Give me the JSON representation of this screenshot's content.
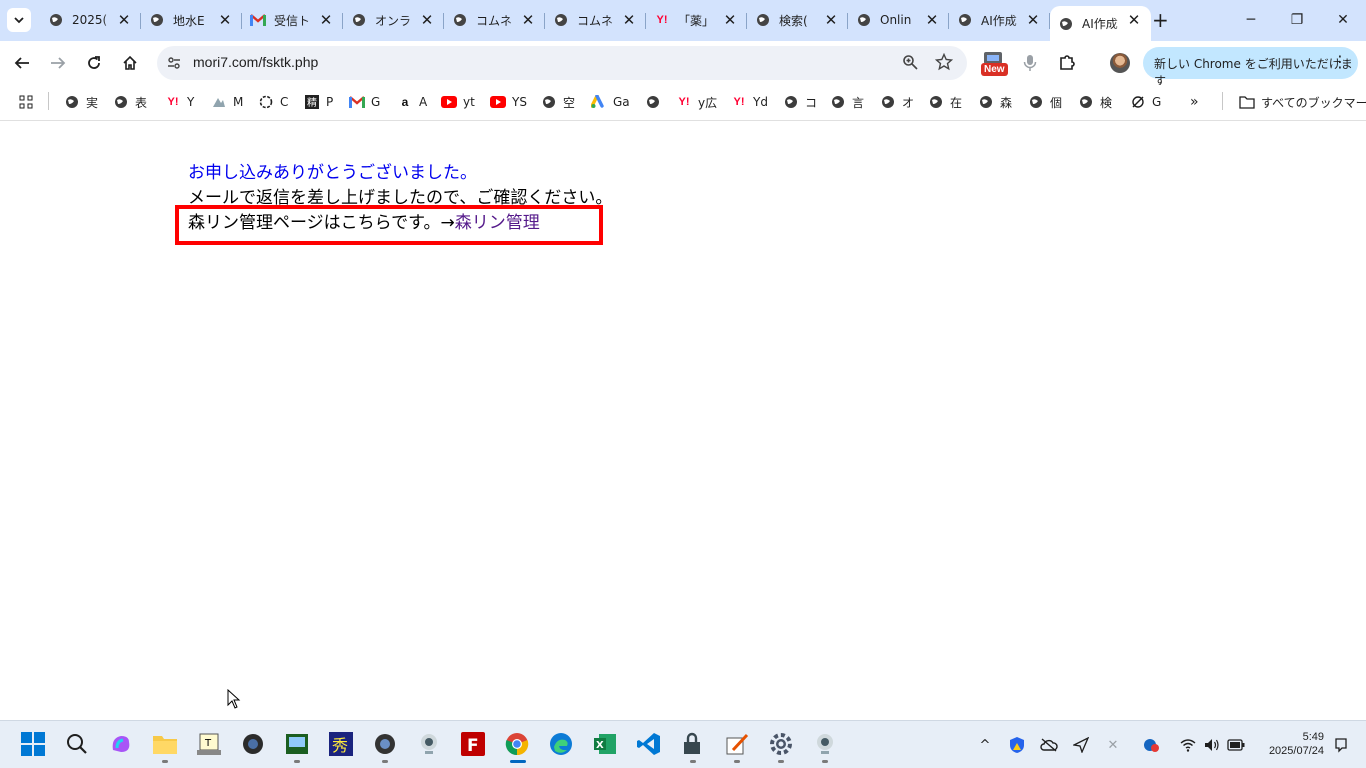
{
  "browser": {
    "tabs": [
      {
        "title": "2025(",
        "favicon": "globe-icon"
      },
      {
        "title": "地水E",
        "favicon": "globe-icon"
      },
      {
        "title": "受信ト",
        "favicon": "gmail-icon"
      },
      {
        "title": "オンラ",
        "favicon": "globe-icon"
      },
      {
        "title": "コムネ",
        "favicon": "globe-icon"
      },
      {
        "title": "コムネ",
        "favicon": "globe-icon"
      },
      {
        "title": "「薬」",
        "favicon": "yahoo-icon"
      },
      {
        "title": "検索(",
        "favicon": "globe-icon"
      },
      {
        "title": "Onlin",
        "favicon": "globe-icon"
      },
      {
        "title": "AI作成",
        "favicon": "globe-icon"
      },
      {
        "title": "AI作成",
        "favicon": "globe-icon",
        "active": true
      }
    ],
    "url": "mori7.com/fsktk.php",
    "new_badge": "New",
    "update_button": "新しい Chrome をご利用いただけます"
  },
  "bookmarks": {
    "items": [
      {
        "label": "実",
        "icon": "globe-icon"
      },
      {
        "label": "表",
        "icon": "globe-icon"
      },
      {
        "label": "Y",
        "icon": "yahoo-icon"
      },
      {
        "label": "M",
        "icon": "mountain-icon"
      },
      {
        "label": "C",
        "icon": "openai-icon"
      },
      {
        "label": "P",
        "icon": "app-icon"
      },
      {
        "label": "G",
        "icon": "gmail-icon"
      },
      {
        "label": "A",
        "icon": "amazon-icon"
      },
      {
        "label": "yt",
        "icon": "youtube-icon"
      },
      {
        "label": "YS",
        "icon": "youtube-icon"
      },
      {
        "label": "空",
        "icon": "globe-icon"
      },
      {
        "label": "Ga",
        "icon": "google-ads-icon"
      },
      {
        "label": "",
        "icon": "globe-icon"
      },
      {
        "label": "y広",
        "icon": "yahoo-icon"
      },
      {
        "label": "Yd",
        "icon": "yahoo-icon"
      },
      {
        "label": "コ",
        "icon": "globe-icon"
      },
      {
        "label": "言",
        "icon": "globe-icon"
      },
      {
        "label": "オ",
        "icon": "globe-icon"
      },
      {
        "label": "在",
        "icon": "globe-icon"
      },
      {
        "label": "森",
        "icon": "globe-icon"
      },
      {
        "label": "個",
        "icon": "globe-icon"
      },
      {
        "label": "検",
        "icon": "globe-icon"
      },
      {
        "label": "G",
        "icon": "slash-icon"
      }
    ],
    "all_bookmarks": "すべてのブックマーク"
  },
  "page": {
    "thanks": "お申し込みありがとうございました。",
    "mail_notice": "メールで返信を差し上げましたので、ご確認ください。",
    "admin_text": "森リン管理ページはこちらです。→",
    "admin_link": "森リン管理"
  },
  "taskbar": {
    "time": "5:49",
    "date": "2025/07/24"
  },
  "colors": {
    "tabstrip": "#d3e3fd",
    "link_blue": "#0000ee",
    "link_visited": "#551a8b",
    "highlight_box": "#ff0000",
    "update_pill": "#c2e7ff"
  }
}
